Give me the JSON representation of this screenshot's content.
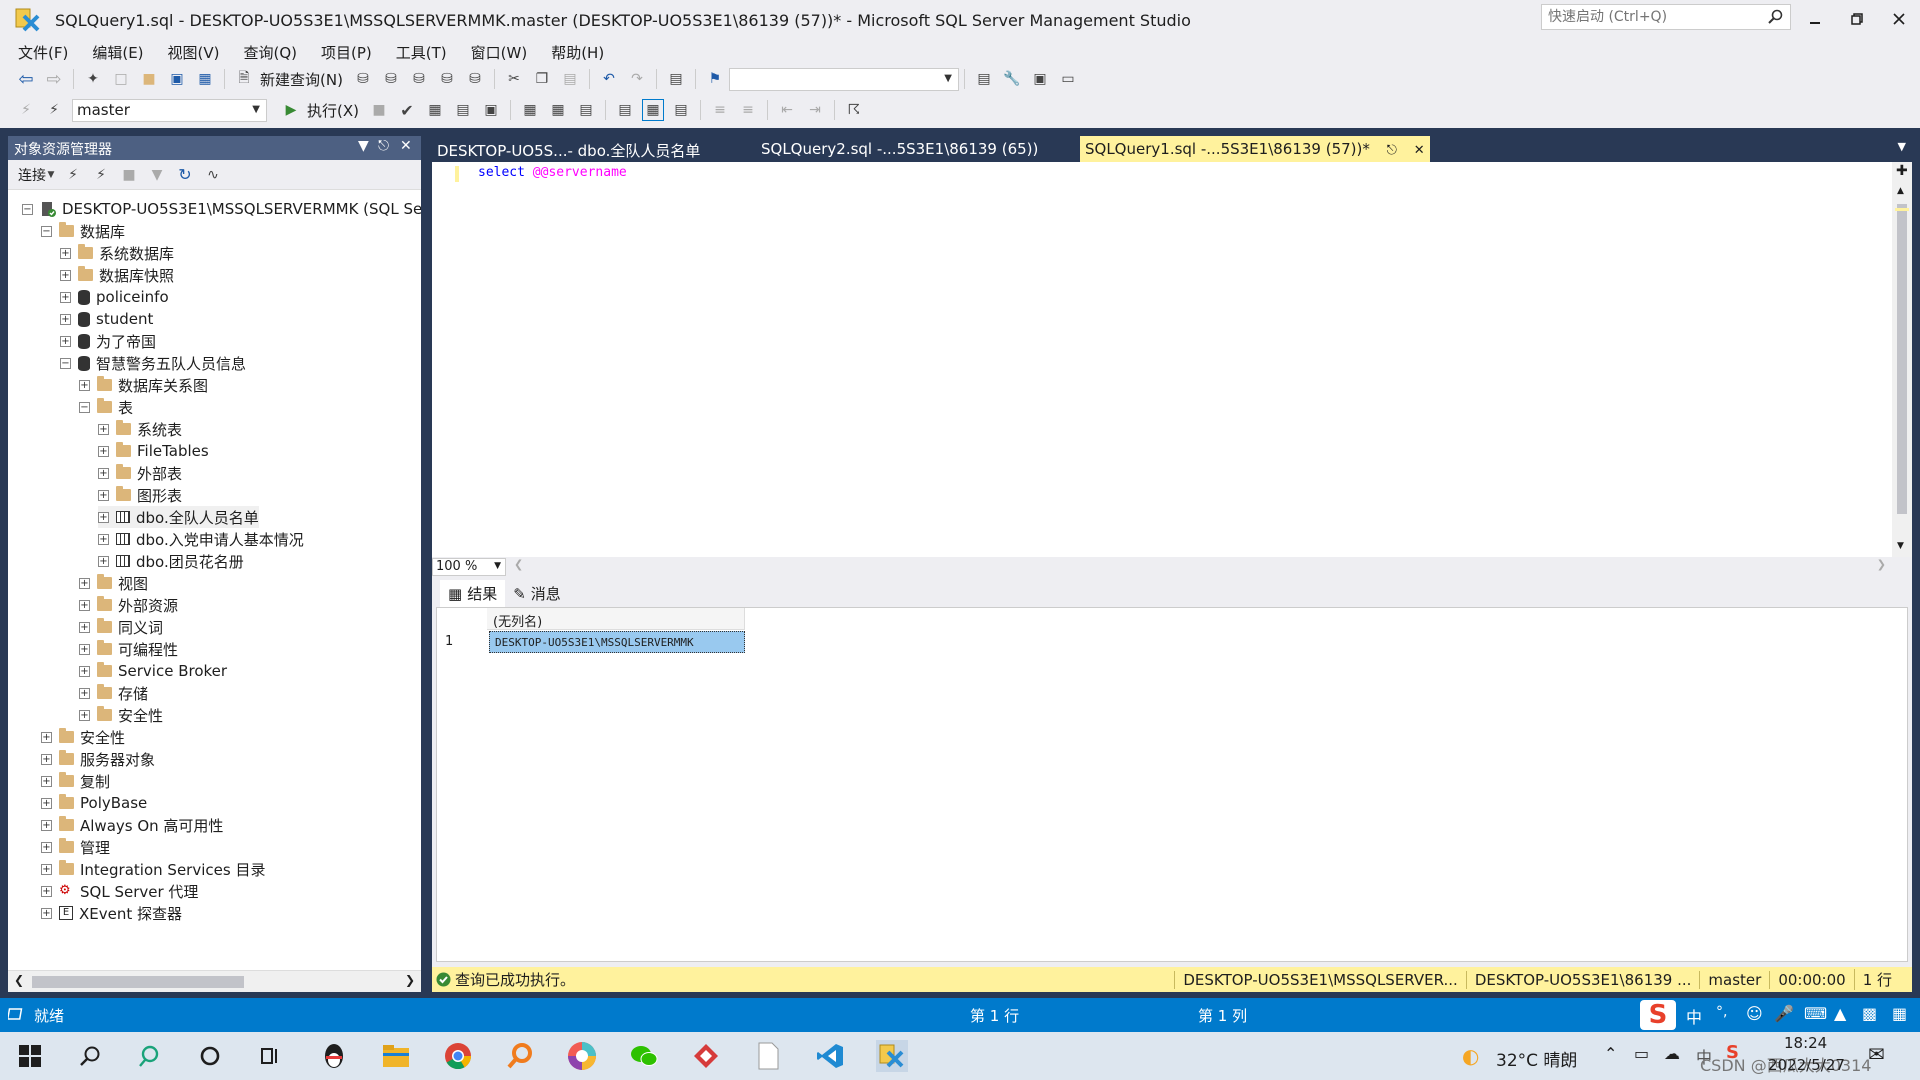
{
  "window": {
    "title": "SQLQuery1.sql - DESKTOP-UO5S3E1\\MSSQLSERVERMMK.master (DESKTOP-UO5S3E1\\86139 (57))* - Microsoft SQL Server Management Studio",
    "quick_launch_placeholder": "快速启动 (Ctrl+Q)"
  },
  "menu": [
    "文件(F)",
    "编辑(E)",
    "视图(V)",
    "查询(Q)",
    "项目(P)",
    "工具(T)",
    "窗口(W)",
    "帮助(H)"
  ],
  "toolbar": {
    "new_query": "新建查询(N)",
    "database_value": "master",
    "execute": "执行(X)"
  },
  "object_explorer": {
    "title": "对象资源管理器",
    "connect": "连接",
    "tree": [
      {
        "label": "DESKTOP-UO5S3E1\\MSSQLSERVERMMK (SQL Ser",
        "level": 0,
        "icon": "server",
        "exp": "-"
      },
      {
        "label": "数据库",
        "level": 1,
        "icon": "folder",
        "exp": "-"
      },
      {
        "label": "系统数据库",
        "level": 2,
        "icon": "folder",
        "exp": "+"
      },
      {
        "label": "数据库快照",
        "level": 2,
        "icon": "folder",
        "exp": "+"
      },
      {
        "label": "policeinfo",
        "level": 2,
        "icon": "db",
        "exp": "+"
      },
      {
        "label": "student",
        "level": 2,
        "icon": "db",
        "exp": "+"
      },
      {
        "label": "为了帝国",
        "level": 2,
        "icon": "db",
        "exp": "+"
      },
      {
        "label": "智慧警务五队人员信息",
        "level": 2,
        "icon": "db",
        "exp": "-"
      },
      {
        "label": "数据库关系图",
        "level": 3,
        "icon": "folder",
        "exp": "+"
      },
      {
        "label": "表",
        "level": 3,
        "icon": "folder",
        "exp": "-"
      },
      {
        "label": "系统表",
        "level": 4,
        "icon": "folder",
        "exp": "+"
      },
      {
        "label": "FileTables",
        "level": 4,
        "icon": "folder",
        "exp": "+"
      },
      {
        "label": "外部表",
        "level": 4,
        "icon": "folder",
        "exp": "+"
      },
      {
        "label": "图形表",
        "level": 4,
        "icon": "folder",
        "exp": "+"
      },
      {
        "label": "dbo.全队人员名单",
        "level": 4,
        "icon": "table",
        "exp": "+",
        "selected": true
      },
      {
        "label": "dbo.入党申请人基本情况",
        "level": 4,
        "icon": "table",
        "exp": "+"
      },
      {
        "label": "dbo.团员花名册",
        "level": 4,
        "icon": "table",
        "exp": "+"
      },
      {
        "label": "视图",
        "level": 3,
        "icon": "folder",
        "exp": "+"
      },
      {
        "label": "外部资源",
        "level": 3,
        "icon": "folder",
        "exp": "+"
      },
      {
        "label": "同义词",
        "level": 3,
        "icon": "folder",
        "exp": "+"
      },
      {
        "label": "可编程性",
        "level": 3,
        "icon": "folder",
        "exp": "+"
      },
      {
        "label": "Service Broker",
        "level": 3,
        "icon": "folder",
        "exp": "+"
      },
      {
        "label": "存储",
        "level": 3,
        "icon": "folder",
        "exp": "+"
      },
      {
        "label": "安全性",
        "level": 3,
        "icon": "folder",
        "exp": "+"
      },
      {
        "label": "安全性",
        "level": 1,
        "icon": "folder",
        "exp": "+"
      },
      {
        "label": "服务器对象",
        "level": 1,
        "icon": "folder",
        "exp": "+"
      },
      {
        "label": "复制",
        "level": 1,
        "icon": "folder",
        "exp": "+"
      },
      {
        "label": "PolyBase",
        "level": 1,
        "icon": "folder",
        "exp": "+"
      },
      {
        "label": "Always On 高可用性",
        "level": 1,
        "icon": "folder",
        "exp": "+"
      },
      {
        "label": "管理",
        "level": 1,
        "icon": "folder",
        "exp": "+"
      },
      {
        "label": "Integration Services 目录",
        "level": 1,
        "icon": "folder",
        "exp": "+"
      },
      {
        "label": "SQL Server 代理",
        "level": 1,
        "icon": "agent",
        "exp": "+"
      },
      {
        "label": "XEvent 探查器",
        "level": 1,
        "icon": "xevent",
        "exp": "+"
      }
    ]
  },
  "tabs": [
    {
      "label": "DESKTOP-UO5S...- dbo.全队人员名单"
    },
    {
      "label": "SQLQuery2.sql -...5S3E1\\86139 (65))"
    },
    {
      "label": "SQLQuery1.sql -...5S3E1\\86139 (57))*"
    }
  ],
  "editor": {
    "code_keyword": "select",
    "code_function": "@@servername"
  },
  "zoom": "100 %",
  "results": {
    "tab_results": "结果",
    "tab_messages": "消息",
    "column_header": "(无列名)",
    "row_number": "1",
    "cell_value": "DESKTOP-UO5S3E1\\MSSQLSERVERMMK"
  },
  "query_status": {
    "message": "查询已成功执行。",
    "server": "DESKTOP-UO5S3E1\\MSSQLSERVER...",
    "user": "DESKTOP-UO5S3E1\\86139 ...",
    "database": "master",
    "elapsed": "00:00:00",
    "rows": "1 行"
  },
  "app_status": {
    "ready": "就绪",
    "line": "第 1 行",
    "column": "第 1 列"
  },
  "taskbar": {
    "weather": "32°C  晴朗",
    "time": "18:24",
    "date": "2022/5/27",
    "ime": "中",
    "watermark": "CSDN @西瓜大大0314"
  },
  "colors": {
    "accent_blue": "#007acc",
    "active_tab": "#fff29d",
    "chrome_dark": "#293955",
    "panel_header": "#4d6082"
  }
}
